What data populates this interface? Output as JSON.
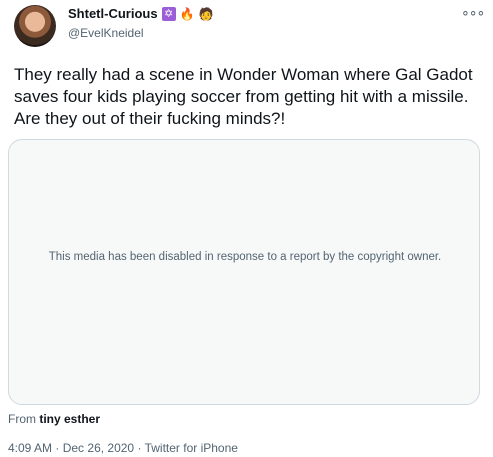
{
  "tweet": {
    "display_name": "Shtetl-Curious",
    "handle": "@EvelKneidel",
    "name_emojis": [
      "✡",
      "🔥",
      "🧑"
    ],
    "text": "They really had a scene in Wonder Woman where Gal Gadot saves four kids playing soccer from getting hit with a missile. Are they out of their fucking minds?!",
    "media_disabled_message": "This media has been disabled in response to a report by the copyright owner.",
    "from_label": "From",
    "from_source": "tiny esther",
    "time": "4:09 AM",
    "date": "Dec 26, 2020",
    "client": "Twitter for iPhone",
    "separator": "·",
    "more_icon": "more-horizontal-icon"
  }
}
